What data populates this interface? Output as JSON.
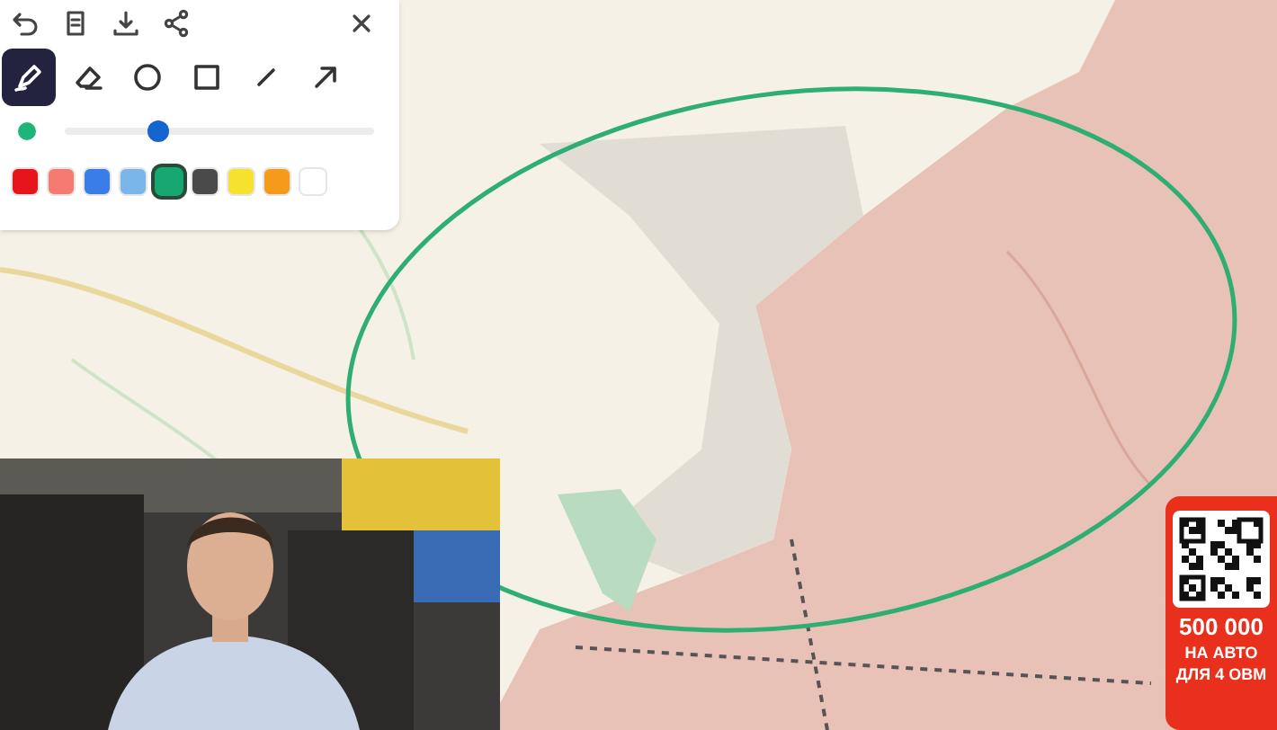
{
  "toolbar": {
    "tools": [
      {
        "kind": "pen",
        "selected": true
      },
      {
        "kind": "eraser",
        "selected": false
      },
      {
        "kind": "circle",
        "selected": false
      },
      {
        "kind": "square",
        "selected": false
      },
      {
        "kind": "line",
        "selected": false
      },
      {
        "kind": "arrow",
        "selected": false
      }
    ],
    "stroke": {
      "color": "#1fb57a",
      "level": 0.3
    },
    "swatches": [
      {
        "color": "#e8141c",
        "selected": false
      },
      {
        "color": "#f47a72",
        "selected": false
      },
      {
        "color": "#3b7de8",
        "selected": false
      },
      {
        "color": "#7ab6ea",
        "selected": false
      },
      {
        "color": "#17a872",
        "selected": true
      },
      {
        "color": "#4a4a4a",
        "selected": false
      },
      {
        "color": "#f5e12e",
        "selected": false
      },
      {
        "color": "#f59a1b",
        "selected": false
      },
      {
        "color": "#ffffff",
        "selected": false
      }
    ]
  },
  "ad": {
    "amount": "500 000",
    "line_1": "НА АВТО",
    "line_2": "ДЛЯ 4 ОВМ"
  }
}
